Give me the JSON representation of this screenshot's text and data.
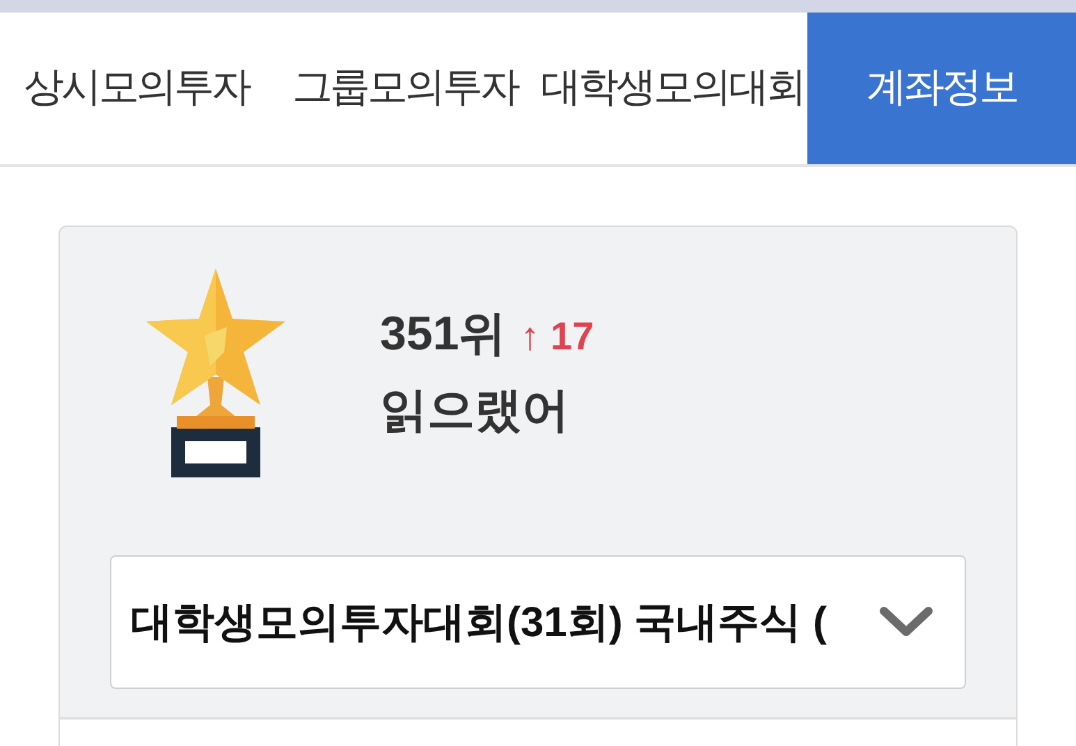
{
  "tabs": [
    {
      "label": "상시모의투자",
      "selected": false
    },
    {
      "label": "그룹모의투자",
      "selected": false
    },
    {
      "label": "대학생모의대회",
      "selected": false
    },
    {
      "label": "계좌정보",
      "selected": true
    }
  ],
  "profile": {
    "rank": "351위",
    "rank_change": "↑ 17",
    "name": "읽으랬어"
  },
  "contest_select": {
    "value": "대학생모의투자대회(31회) 국내주식 ("
  }
}
